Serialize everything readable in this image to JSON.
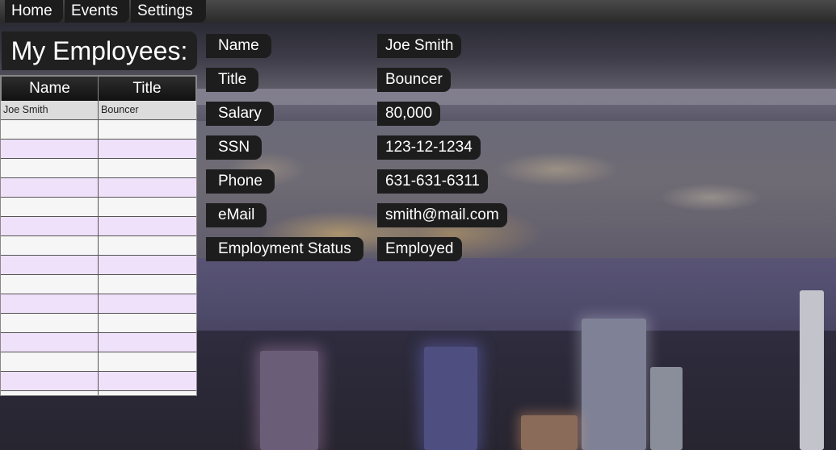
{
  "menu": {
    "items": [
      {
        "label": "Home"
      },
      {
        "label": "Events"
      },
      {
        "label": "Settings"
      }
    ]
  },
  "employees_panel": {
    "title": "My Employees:",
    "columns": [
      "Name",
      "Title"
    ],
    "rows": [
      {
        "name": "Joe Smith",
        "title": "Bouncer"
      }
    ]
  },
  "details": {
    "fields": [
      {
        "label": "Name",
        "value": "Joe Smith"
      },
      {
        "label": "Title",
        "value": "Bouncer"
      },
      {
        "label": "Salary",
        "value": "80,000"
      },
      {
        "label": "SSN",
        "value": "123-12-1234"
      },
      {
        "label": "Phone",
        "value": "631-631-6311"
      },
      {
        "label": "eMail",
        "value": "smith@mail.com"
      },
      {
        "label": "Employment Status",
        "value": "Employed"
      }
    ]
  },
  "colors": {
    "tag_background": "#1d1d1d",
    "row_alt": "#f0e1fb",
    "row_selected": "#dcdcdc"
  }
}
